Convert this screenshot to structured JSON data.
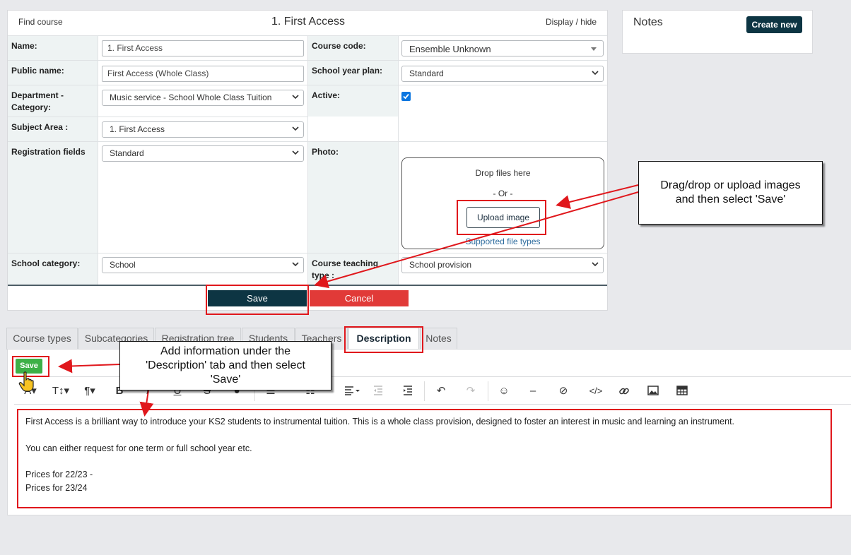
{
  "course_header": {
    "find_course": "Find course",
    "title": "1. First Access",
    "display_hide": "Display / hide"
  },
  "form": {
    "name": {
      "label": "Name:",
      "value": "1. First Access"
    },
    "course_code": {
      "label": "Course code:",
      "value": "Ensemble Unknown"
    },
    "public_name": {
      "label": "Public name:",
      "value": "First Access (Whole Class)"
    },
    "school_year_plan": {
      "label": "School year plan:",
      "value": "Standard"
    },
    "department_category": {
      "label_line1": "Department -",
      "label_line2": "Category:",
      "value": "Music service - School Whole Class Tuition"
    },
    "active": {
      "label": "Active:",
      "checked": true
    },
    "subject_area": {
      "label": "Subject Area :",
      "value": "1. First Access"
    },
    "registration_fields": {
      "label": "Registration fields",
      "value": "Standard"
    },
    "photo": {
      "label": "Photo:",
      "drop_text": "Drop files here",
      "or_text": "- Or -",
      "upload_button": "Upload image",
      "supported_link": "Supported file types"
    },
    "school_category": {
      "label": "School category:",
      "value": "School"
    },
    "course_teaching_type": {
      "label_line1": "Course teaching",
      "label_line2": "type :",
      "value": "School provision"
    },
    "save_button": "Save",
    "cancel_button": "Cancel"
  },
  "notes_panel": {
    "title": "Notes",
    "create_button": "Create new"
  },
  "tabs": [
    {
      "label": "Course types",
      "active": false
    },
    {
      "label": "Subcategories",
      "active": false
    },
    {
      "label": "Registration tree",
      "active": false
    },
    {
      "label": "Students",
      "active": false
    },
    {
      "label": "Teachers",
      "active": false
    },
    {
      "label": "Description",
      "active": true
    },
    {
      "label": "Notes",
      "active": false
    }
  ],
  "description": {
    "save_button": "Save",
    "toolbar": [
      "font-icon",
      "text-size-icon",
      "paragraph-icon",
      "bold-icon",
      "italic-icon",
      "underline-icon",
      "strikethrough-icon",
      "color-icon",
      "bullet-list-icon",
      "numbered-list-icon",
      "align-icon",
      "outdent-icon",
      "indent-icon",
      "undo-icon",
      "redo-icon",
      "emoji-icon",
      "horizontal-rule-icon",
      "clear-format-icon",
      "code-icon",
      "link-icon",
      "image-icon",
      "table-icon"
    ],
    "lines": [
      "First Access is a brilliant way to introduce your KS2 students to instrumental tuition. This is a whole class provision, designed to foster an interest in music and learning an instrument.",
      "You can either request for one term or full school year etc.",
      "Prices for 22/23 -",
      "Prices for 23/24"
    ]
  },
  "annotations": {
    "upload_callout_line1": "Drag/drop or upload images",
    "upload_callout_line2": "and then select 'Save'",
    "description_callout_line1": "Add information under the",
    "description_callout_line2": "'Description' tab and then select",
    "description_callout_line3": "'Save'"
  },
  "colors": {
    "primary_dark": "#0d3543",
    "cancel_red": "#e13a38",
    "save_green": "#3db047",
    "annotation_red": "#e0171c",
    "label_bg": "#eef3f3"
  }
}
